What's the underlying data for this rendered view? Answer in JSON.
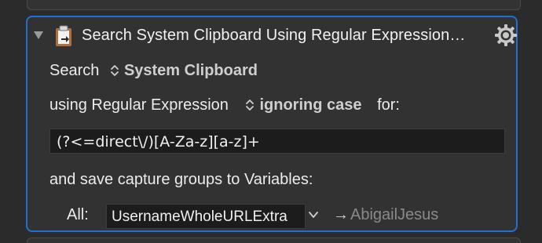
{
  "action": {
    "title": "Search System Clipboard Using Regular Expression…",
    "search_label": "Search",
    "source_popup": "System Clipboard",
    "using_label": "using Regular Expression",
    "case_popup": "ignoring case",
    "for_label": "for:",
    "regex": "(?<=direct\\/)[A-Za-z][a-z]+",
    "save_label": "and save capture groups to Variables:",
    "all_label": "All:",
    "variable_name": "UsernameWholeURLExtra",
    "variable_value": "AbigailJesus"
  },
  "colors": {
    "selection_border": "#1f6fd6",
    "panel_bg": "#323232",
    "field_bg": "#1c1c1c"
  },
  "icons": {
    "disclosure": "disclosure-triangle-icon",
    "action": "clipboard-icon",
    "settings": "gear-icon",
    "popup": "up-down-chevron-icon",
    "menu": "chevron-down-icon",
    "arrow": "right-arrow-icon"
  }
}
